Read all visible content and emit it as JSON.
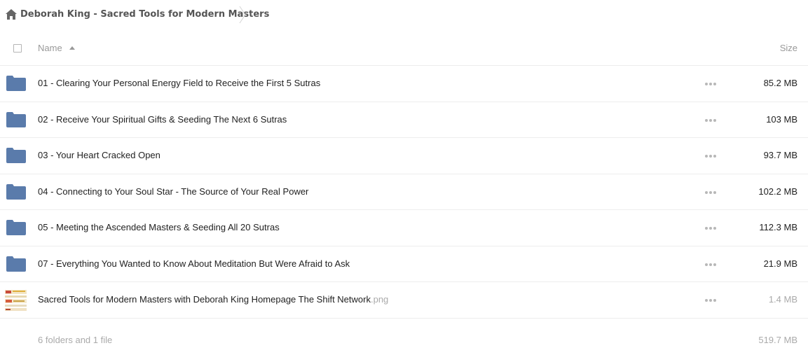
{
  "breadcrumb": {
    "home_icon": "home-icon",
    "folder_title": "Deborah King - Sacred Tools for Modern Masters"
  },
  "header": {
    "name_label": "Name",
    "size_label": "Size",
    "sort": "ascending"
  },
  "colors": {
    "folder": "#5a7bab",
    "text": "#222222",
    "muted": "#aaaaaa",
    "divider": "#ededed"
  },
  "items": [
    {
      "type": "folder",
      "name": "01 - Clearing Your Personal Energy Field to Receive the First 5 Sutras",
      "ext": "",
      "size": "85.2 MB"
    },
    {
      "type": "folder",
      "name": "02 - Receive Your Spiritual Gifts & Seeding The Next 6 Sutras",
      "ext": "",
      "size": "103 MB"
    },
    {
      "type": "folder",
      "name": "03 - Your Heart Cracked Open",
      "ext": "",
      "size": "93.7 MB"
    },
    {
      "type": "folder",
      "name": "04 - Connecting to Your Soul Star - The Source of Your Real Power",
      "ext": "",
      "size": "102.2 MB"
    },
    {
      "type": "folder",
      "name": "05 - Meeting the Ascended Masters & Seeding All 20 Sutras",
      "ext": "",
      "size": "112.3 MB"
    },
    {
      "type": "folder",
      "name": "07 - Everything You Wanted to Know About Meditation But Were Afraid to Ask",
      "ext": "",
      "size": "21.9 MB"
    },
    {
      "type": "file",
      "name": "Sacred Tools for Modern Masters with Deborah King Homepage The Shift Network",
      "ext": ".png",
      "size": "1.4 MB"
    }
  ],
  "summary": {
    "count_text": "6 folders and 1 file",
    "total_size": "519.7 MB"
  }
}
